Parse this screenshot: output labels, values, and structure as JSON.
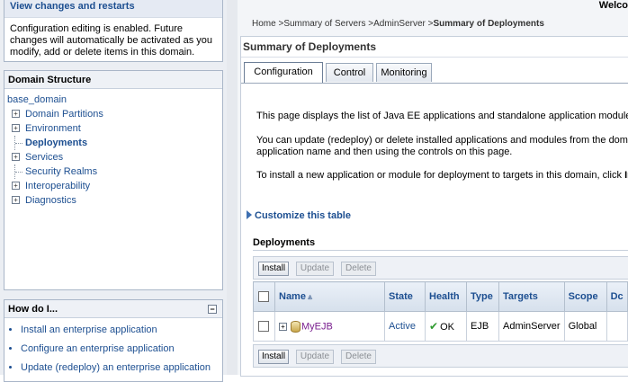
{
  "change_center": {
    "title": "View changes and restarts",
    "text": "Configuration editing is enabled. Future changes will automatically be activated as you modify, add or delete items in this domain."
  },
  "domain_structure": {
    "title": "Domain Structure",
    "root": "base_domain",
    "items": [
      {
        "label": "Domain Partitions",
        "expandable": true
      },
      {
        "label": "Environment",
        "expandable": true
      },
      {
        "label": "Deployments",
        "expandable": false,
        "selected": true
      },
      {
        "label": "Services",
        "expandable": true
      },
      {
        "label": "Security Realms",
        "expandable": false
      },
      {
        "label": "Interoperability",
        "expandable": true
      },
      {
        "label": "Diagnostics",
        "expandable": true
      }
    ]
  },
  "how_do_i": {
    "title": "How do I...",
    "links": [
      "Install an enterprise application",
      "Configure an enterprise application",
      "Update (redeploy) an enterprise application"
    ]
  },
  "header": {
    "welcome": "Welco"
  },
  "breadcrumb": {
    "home": "Home",
    "sep": " >",
    "servers": "Summary of Servers",
    "admin": "AdminServer",
    "current": "Summary of Deployments"
  },
  "page": {
    "title": "Summary of Deployments",
    "tabs": [
      "Configuration",
      "Control",
      "Monitoring"
    ],
    "desc1": "This page displays the list of Java EE applications and standalone application modules i",
    "desc2a": "You can update (redeploy) or delete installed applications and modules from the domai",
    "desc2b": "application name and then using the controls on this page.",
    "desc3": "To install a new application or module for deployment to targets in this domain, click",
    "desc3_bold": "In",
    "customize": "Customize this table"
  },
  "deployments": {
    "title": "Deployments",
    "buttons": {
      "install": "Install",
      "update": "Update",
      "delete": "Delete"
    },
    "columns": [
      "Name",
      "State",
      "Health",
      "Type",
      "Targets",
      "Scope",
      "Dc"
    ],
    "rows": [
      {
        "name": "MyEJB",
        "state": "Active",
        "health": "OK",
        "type": "EJB",
        "targets": "AdminServer",
        "scope": "Global"
      }
    ]
  }
}
